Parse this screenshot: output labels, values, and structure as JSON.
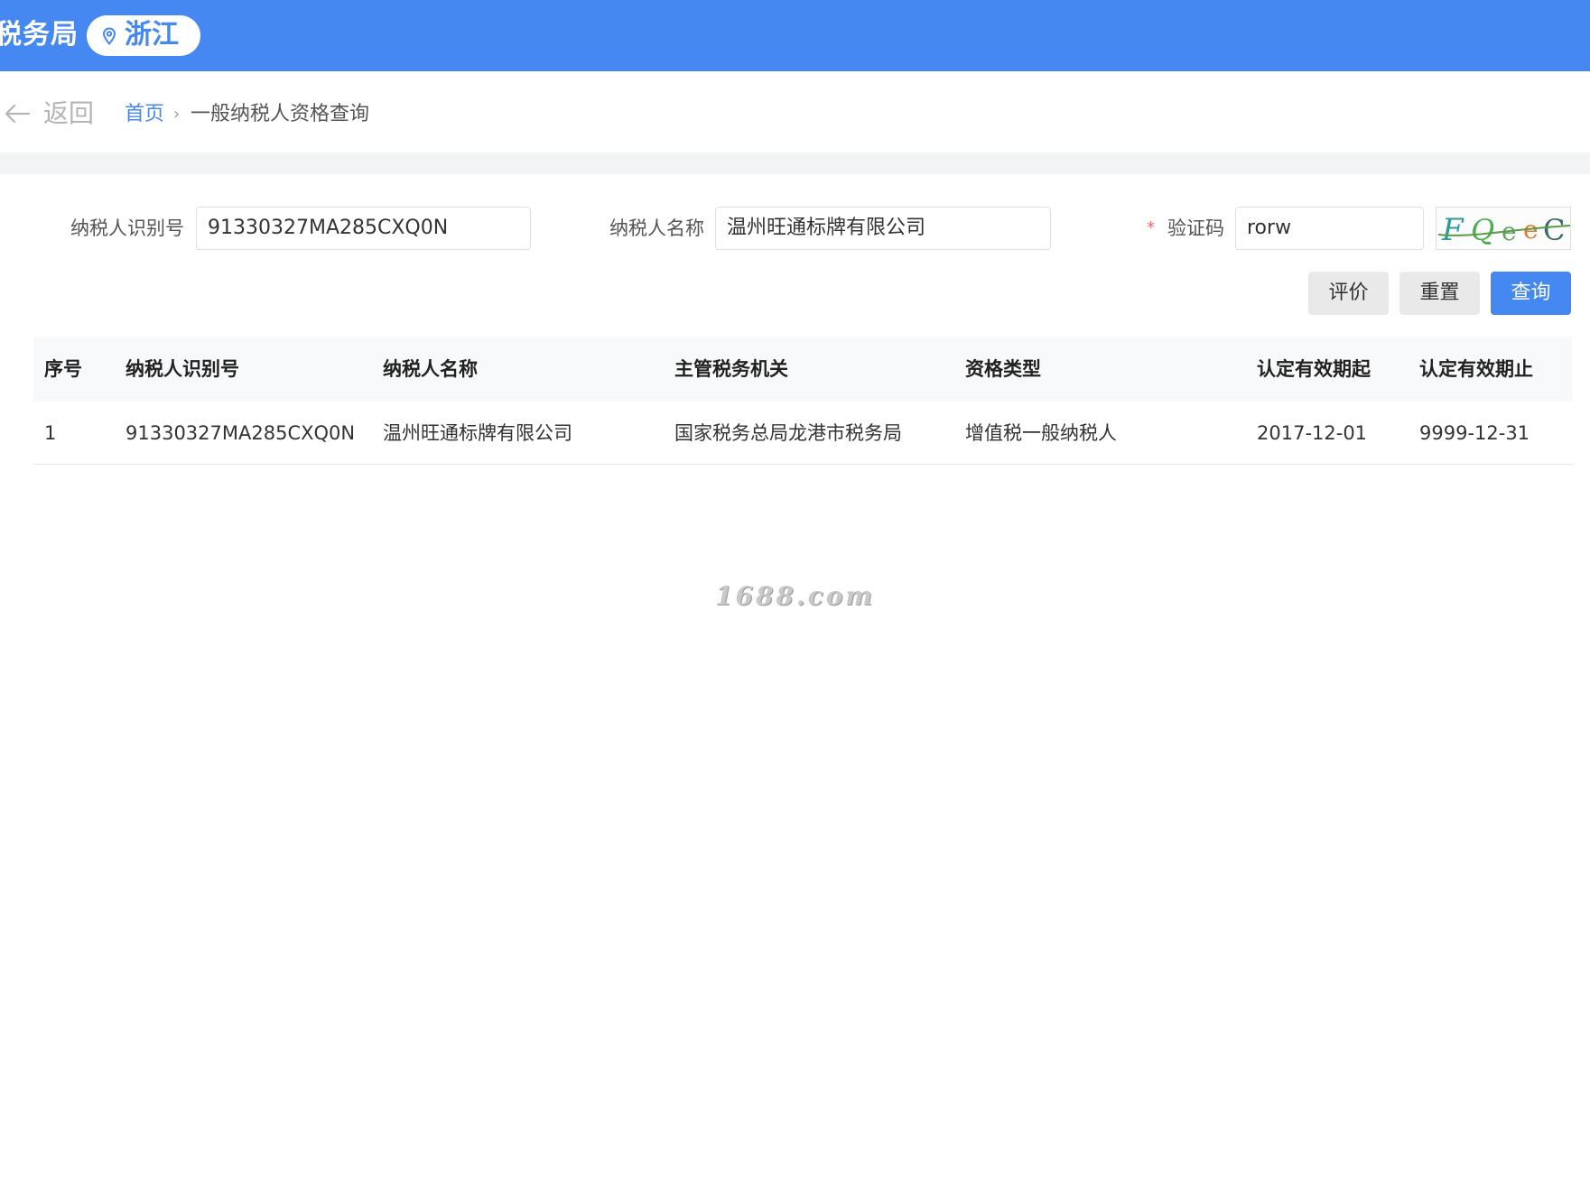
{
  "header": {
    "site_title": "税务局",
    "region": "浙江"
  },
  "breadcrumb": {
    "back_label": "返回",
    "home": "首页",
    "separator": "›",
    "current": "一般纳税人资格查询"
  },
  "form": {
    "taxpayer_id_label": "纳税人识别号",
    "taxpayer_id_value": "91330327MA285CXQ0N",
    "taxpayer_name_label": "纳税人名称",
    "taxpayer_name_value": "温州旺通标牌有限公司",
    "captcha_required": "*",
    "captcha_label": "验证码",
    "captcha_value": "rorw",
    "captcha_image_text": "FQeeC"
  },
  "actions": {
    "evaluate": "评价",
    "reset": "重置",
    "query": "查询"
  },
  "table": {
    "columns": [
      "序号",
      "纳税人识别号",
      "纳税人名称",
      "主管税务机关",
      "资格类型",
      "认定有效期起",
      "认定有效期止"
    ],
    "rows": [
      [
        "1",
        "91330327MA285CXQ0N",
        "温州旺通标牌有限公司",
        "国家税务总局龙港市税务局",
        "增值税一般纳税人",
        "2017-12-01",
        "9999-12-31"
      ]
    ]
  },
  "watermark": "1688.com",
  "colors": {
    "brand_blue": "#4688f1",
    "required_red": "#f56c6c"
  }
}
